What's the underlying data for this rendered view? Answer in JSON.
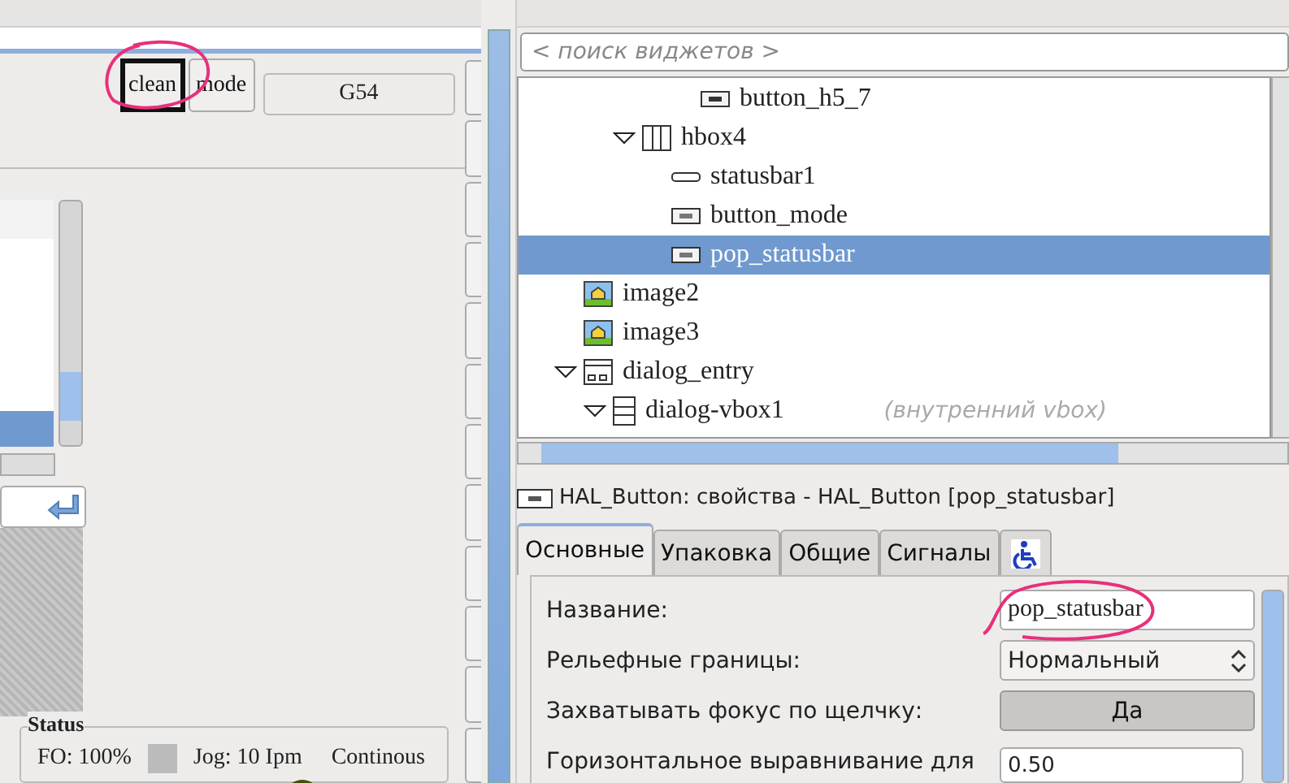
{
  "toolbar": {
    "buttons": [
      {
        "label": "clean",
        "selected": true
      },
      {
        "label": "mode",
        "selected": false
      }
    ],
    "coord_system": "G54"
  },
  "status": {
    "title": "Status",
    "feed_override": "FO: 100%",
    "jog": "Jog: 10 Ipm",
    "jog_mode": "Continous"
  },
  "widget_search": {
    "placeholder": "< поиск виджетов >"
  },
  "tree": {
    "branch_above": {
      "tail": [
        {
          "label": "button_h5_7",
          "kind": "toggle",
          "selected": false
        }
      ],
      "items": [
        {
          "label": "hbox4",
          "kind": "hbox",
          "expanded": true,
          "selected": false,
          "children": [
            {
              "label": "statusbar1",
              "kind": "statusbar",
              "selected": false
            },
            {
              "label": "button_mode",
              "kind": "button",
              "selected": false
            },
            {
              "label": "pop_statusbar",
              "kind": "button",
              "selected": true
            }
          ]
        }
      ]
    },
    "items": [
      {
        "label": "image2",
        "kind": "image",
        "selected": false
      },
      {
        "label": "image3",
        "kind": "image",
        "selected": false
      },
      {
        "label": "dialog_entry",
        "kind": "dialog",
        "expanded": true,
        "selected": false,
        "children": [
          {
            "label": "dialog-vbox1",
            "kind": "vbox",
            "expanded": true,
            "selected": false,
            "hint": "(внутренний vbox)"
          }
        ]
      }
    ]
  },
  "properties": {
    "title": "HAL_Button: свойства - HAL_Button [pop_statusbar]",
    "tabs": [
      {
        "label": "Основные",
        "selected": true
      },
      {
        "label": "Упаковка",
        "selected": false
      },
      {
        "label": "Общие",
        "selected": false
      },
      {
        "label": "Сигналы",
        "selected": false
      }
    ],
    "rows": [
      {
        "label": "Название:",
        "kind": "entry",
        "value": "pop_statusbar"
      },
      {
        "label": "Рельефные границы:",
        "kind": "combo",
        "value": "Нормальный"
      },
      {
        "label": "Захватывать фокус по щелчку:",
        "kind": "toggle",
        "value": "Да",
        "on": true
      },
      {
        "label": "Горизонтальное выравнивание для",
        "kind": "spin",
        "value": "0.50"
      }
    ]
  }
}
